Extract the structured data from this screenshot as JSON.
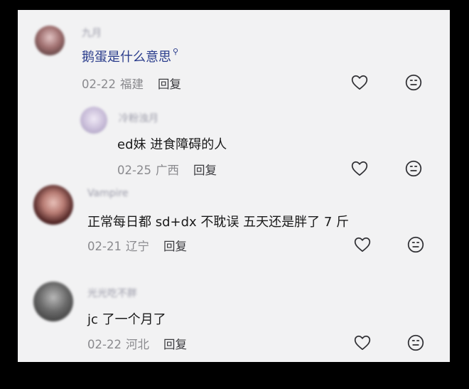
{
  "comments": [
    {
      "username": "九月",
      "text": "鹅蛋是什么意思",
      "date": "02-22",
      "location": "福建",
      "reply_label": "回复",
      "avatar_colors": [
        "#d9b8b8",
        "#6b4848"
      ]
    },
    {
      "username": "冷粉浊月",
      "text": "ed妹 进食障碍的人",
      "date": "02-25",
      "location": "广西",
      "reply_label": "回复",
      "avatar_colors": [
        "#e8e0f0",
        "#b0a8c8"
      ]
    },
    {
      "username": "Vampire",
      "text": "正常每日都 sd+dx 不耽误 五天还是胖了 7 斤",
      "date": "02-21",
      "location": "辽宁",
      "reply_label": "回复",
      "avatar_colors": [
        "#c98f8f",
        "#5a2a2a"
      ]
    },
    {
      "username": "光光吃不胖",
      "text": "jc 了一个月了",
      "date": "02-22",
      "location": "河北",
      "reply_label": "回复",
      "avatar_colors": [
        "#a8a8a8",
        "#3a3a3a"
      ]
    }
  ],
  "icons": {
    "like": "heart-outline-icon",
    "dislike": "sad-face-icon",
    "search_hint": "search-icon"
  },
  "colors": {
    "background": "#000000",
    "panel": "#f2f2f3",
    "highlight_text": "#2b3d8c"
  }
}
